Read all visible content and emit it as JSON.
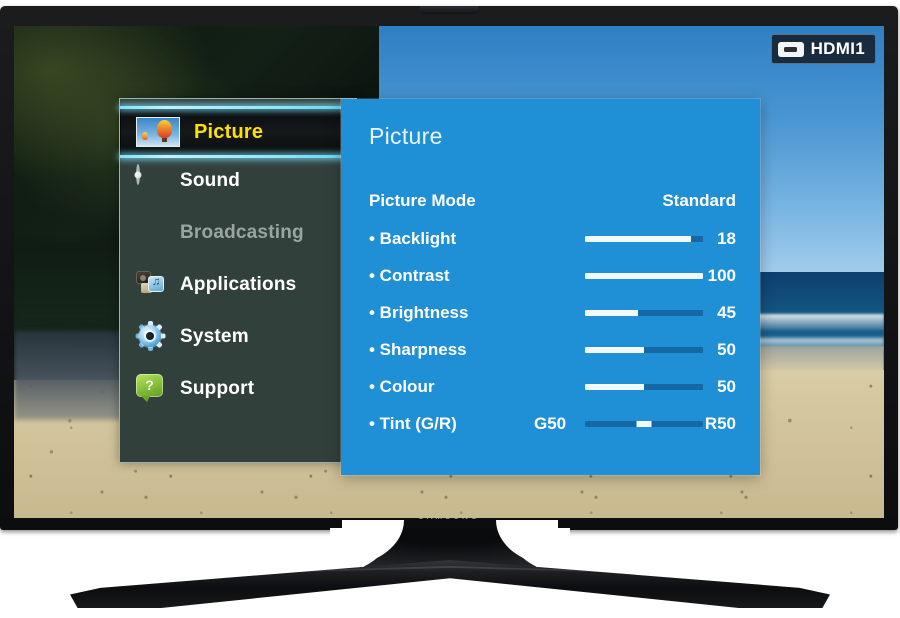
{
  "device": {
    "brand": "SAMSUNG",
    "input_badge": {
      "icon": "hdmi-port-icon",
      "label": "HDMI1"
    }
  },
  "sidebar": {
    "items": [
      {
        "label": "Picture",
        "icon": "balloon-photo-icon",
        "selected": true,
        "dim": false
      },
      {
        "label": "Sound",
        "icon": "speaker-icon",
        "selected": false,
        "dim": false
      },
      {
        "label": "Broadcasting",
        "icon": "satellite-dish-icon",
        "selected": false,
        "dim": true
      },
      {
        "label": "Applications",
        "icon": "applications-icon",
        "selected": false,
        "dim": false
      },
      {
        "label": "System",
        "icon": "gear-icon",
        "selected": false,
        "dim": false
      },
      {
        "label": "Support",
        "icon": "help-bubble-icon",
        "selected": false,
        "dim": false
      }
    ]
  },
  "panel": {
    "title": "Picture",
    "picture_mode": {
      "label": "Picture Mode",
      "value": "Standard"
    },
    "settings": [
      {
        "label": "• Backlight",
        "value": "18",
        "fill_percent": 90,
        "type": "bar"
      },
      {
        "label": "• Contrast",
        "value": "100",
        "fill_percent": 100,
        "type": "bar"
      },
      {
        "label": "• Brightness",
        "value": "45",
        "fill_percent": 45,
        "type": "bar"
      },
      {
        "label": "• Sharpness",
        "value": "50",
        "fill_percent": 50,
        "type": "bar"
      },
      {
        "label": "• Colour",
        "value": "50",
        "fill_percent": 50,
        "type": "bar"
      },
      {
        "label": "• Tint (G/R)",
        "value": "R50",
        "left_value": "G50",
        "knob_percent": 50,
        "type": "knob"
      }
    ]
  },
  "colors": {
    "panel_blue": "#1f8fd6",
    "sidebar_dark": "#32403c",
    "selected_text_yellow": "#ffe000",
    "selection_glow_cyan": "#8fe6ff",
    "slider_track": "#1668a4",
    "slider_fill": "#f3f8fb"
  }
}
